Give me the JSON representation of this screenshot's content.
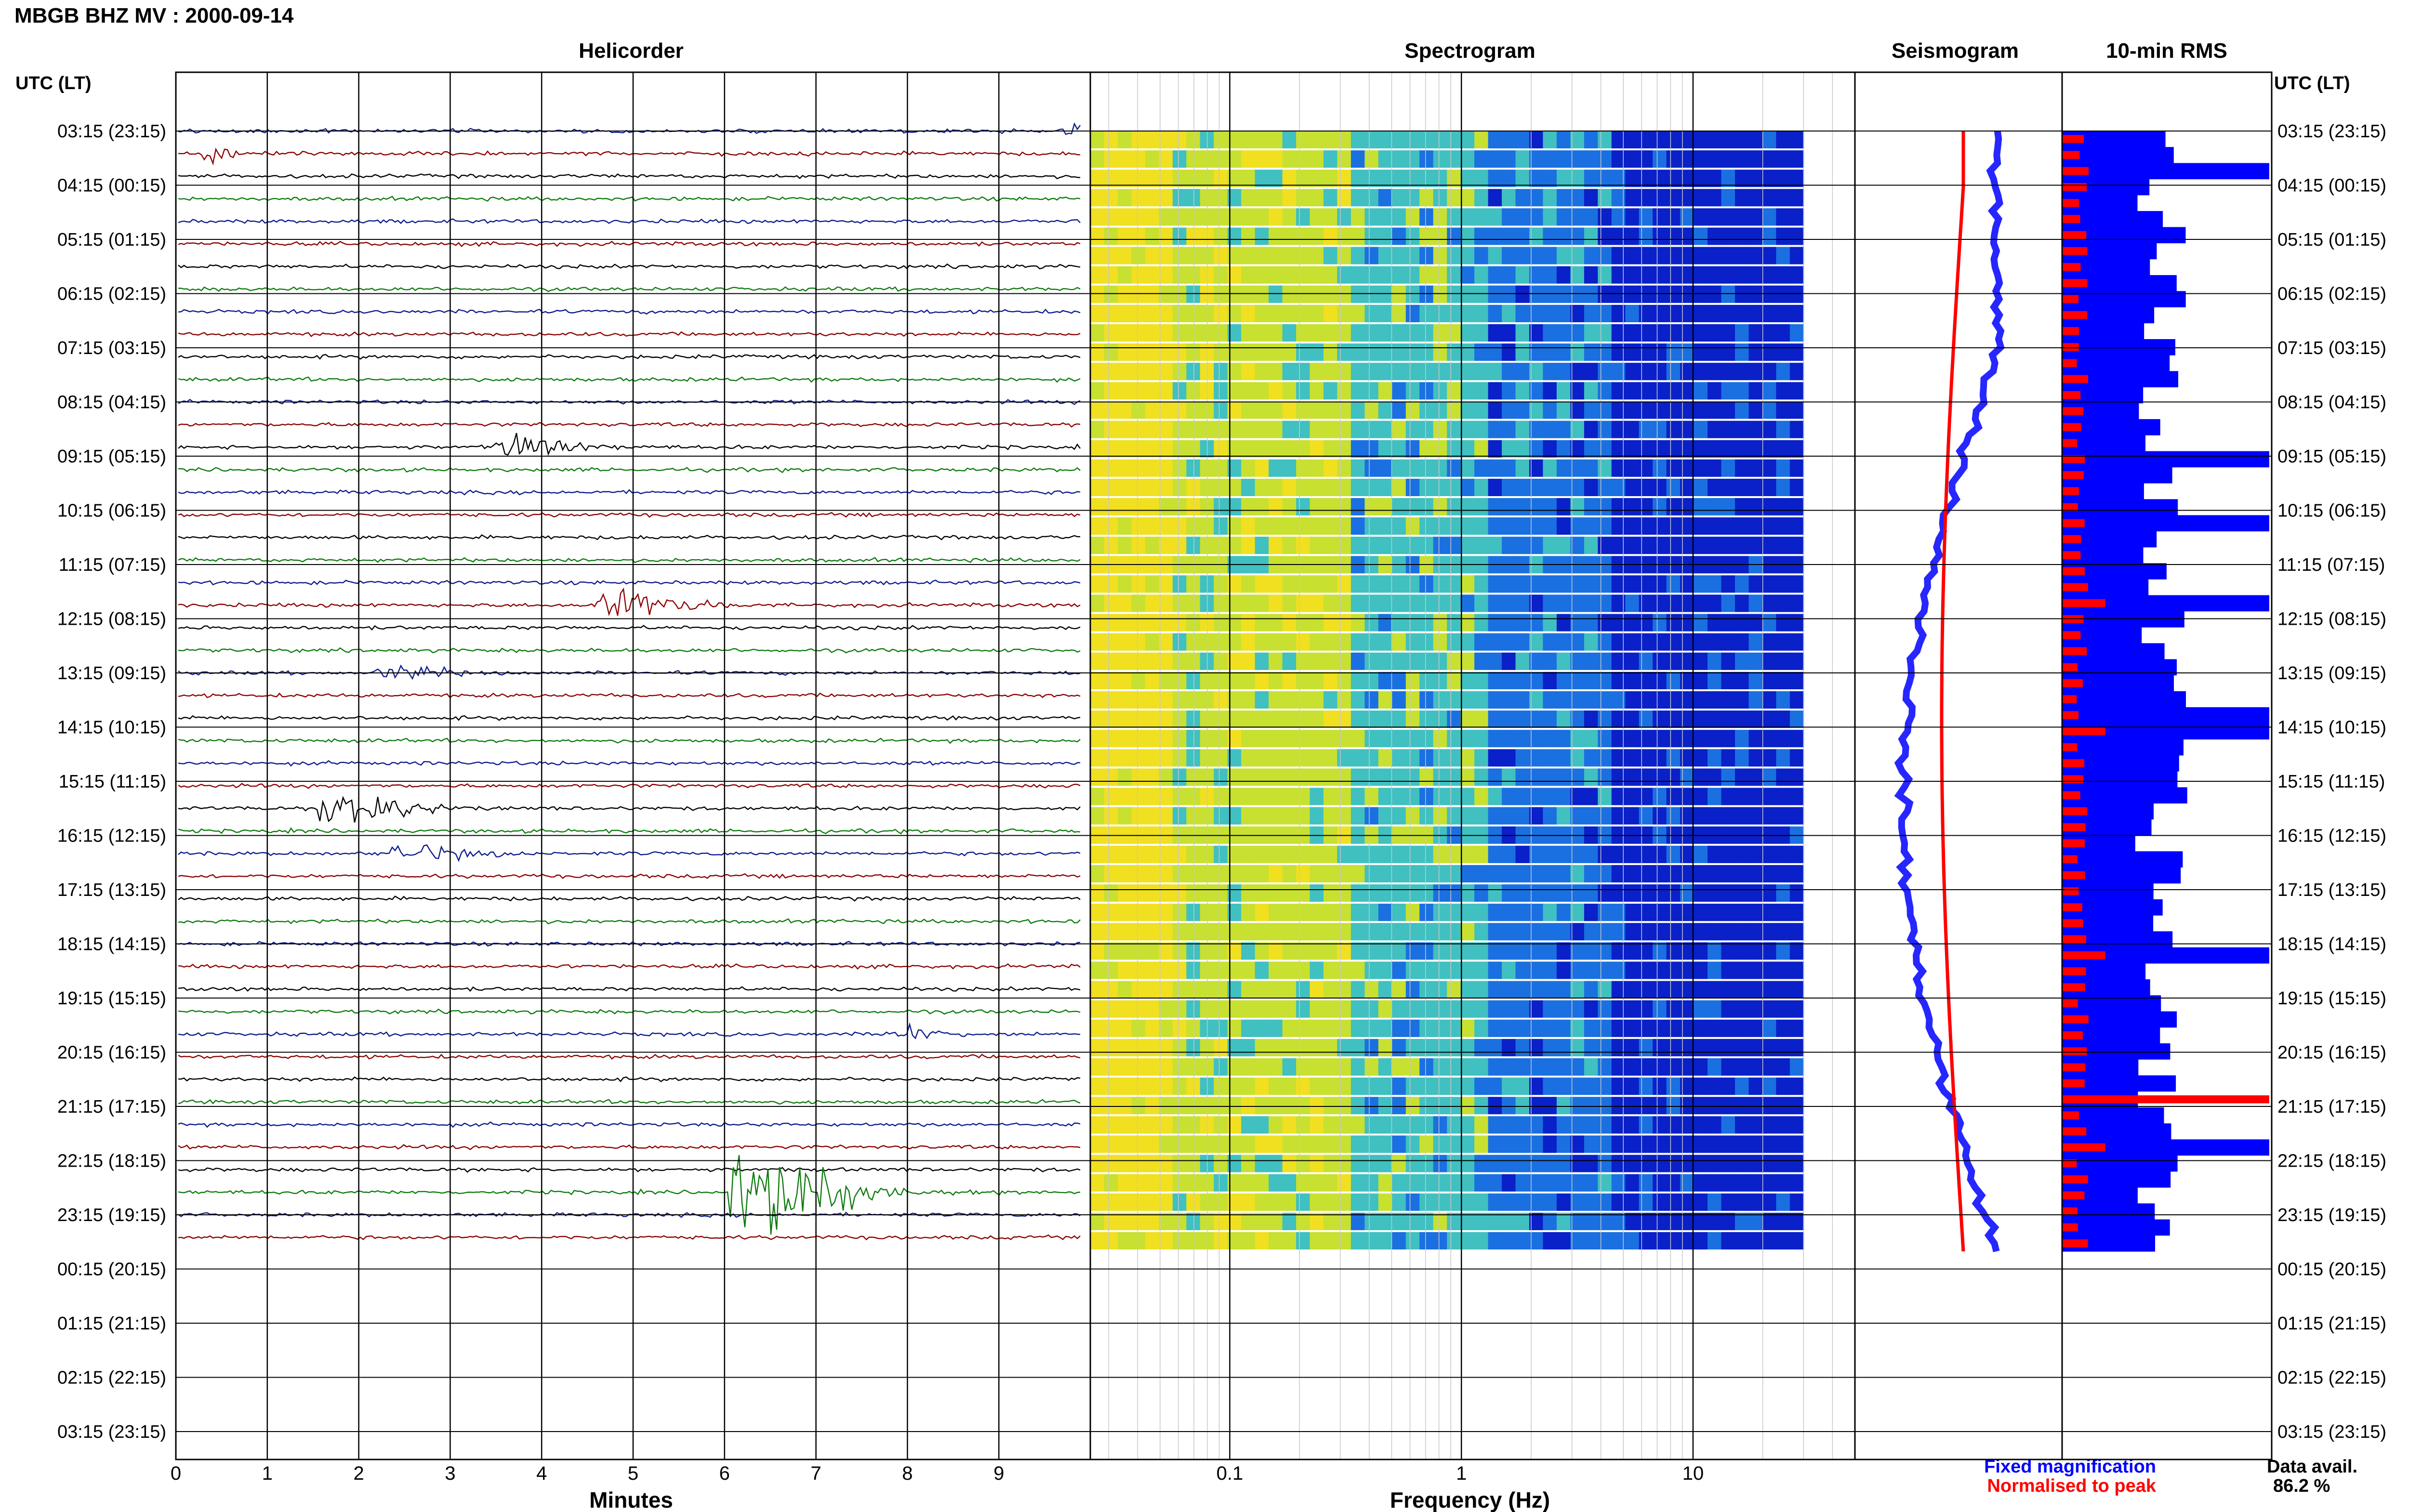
{
  "header": {
    "station_title": "MBGB BHZ MV : 2000-09-14",
    "utc_label": "UTC (LT)",
    "utc_label_right": "UTC (LT)"
  },
  "chart_data": {
    "type": "composite",
    "panels": [
      {
        "name": "helicorder",
        "title": "Helicorder",
        "xlabel": "Minutes",
        "x_ticks": [
          "0",
          "1",
          "2",
          "3",
          "4",
          "5",
          "6",
          "7",
          "8",
          "9"
        ],
        "xlim": [
          0,
          10
        ],
        "trace_colors": [
          "#0a1a8c",
          "#8b0000",
          "#000000",
          "#0b7a0b"
        ],
        "traces_per_row_hour": 6,
        "data_rows": 73,
        "events": [
          {
            "minute": 0.5,
            "row": 1,
            "amp": 14,
            "color": "#0a1a8c",
            "dur": 1.0
          },
          {
            "minute": 9.8,
            "row": 0,
            "amp": 16,
            "color": "#8b0000",
            "dur": 0.3
          },
          {
            "minute": 3.7,
            "row": 14,
            "amp": 22,
            "color": "#0a1a8c",
            "dur": 1.6
          },
          {
            "minute": 4.8,
            "row": 21,
            "amp": 30,
            "color": "#0b7a0b",
            "dur": 1.8
          },
          {
            "minute": 2.4,
            "row": 24,
            "amp": 14,
            "color": "#0a1a8c",
            "dur": 1.5
          },
          {
            "minute": 1.8,
            "row": 30,
            "amp": 45,
            "color": "#000000",
            "dur": 1.8
          },
          {
            "minute": 2.6,
            "row": 32,
            "amp": 14,
            "color": "#8b0000",
            "dur": 2.0
          },
          {
            "minute": 6.3,
            "row": 47,
            "amp": 70,
            "color": "#0a1a8c",
            "dur": 2.5
          },
          {
            "minute": 8.0,
            "row": 40,
            "amp": 12,
            "color": "#0a1a8c",
            "dur": 0.8
          },
          {
            "minute": 8.5,
            "row": 60,
            "amp": 24,
            "color": "#0a1a8c",
            "dur": 1.0
          },
          {
            "minute": 3.0,
            "row": 61,
            "amp": 14,
            "color": "#0b7a0b",
            "dur": 1.3
          },
          {
            "minute": 3.0,
            "row": 53,
            "amp": 10,
            "color": "#8b0000",
            "dur": 0.6
          }
        ]
      },
      {
        "name": "spectrogram",
        "title": "Spectrogram",
        "xlabel": "Frequency (Hz)",
        "x_scale": "log",
        "x_ticks": [
          "0.1",
          "1",
          "10"
        ],
        "xlim": [
          0.025,
          50
        ],
        "data_fmax": 30,
        "colormap": [
          "#f0e020",
          "#c8e030",
          "#40c0c0",
          "#1a70e0",
          "#0a20c8"
        ]
      },
      {
        "name": "seismogram",
        "title": "Seismogram",
        "legend": [
          {
            "label": "Fixed magnification",
            "color": "#0000ff"
          },
          {
            "label": "Normalised to peak",
            "color": "#ff0000"
          }
        ]
      },
      {
        "name": "rms",
        "title": "10-min RMS",
        "series": [
          {
            "name": "Fixed magnification",
            "color": "#0000ff"
          },
          {
            "name": "Normalised to peak",
            "color": "#ff0000"
          }
        ],
        "data_availability_label": "Data avail.",
        "data_availability_value": "86.2 %"
      }
    ],
    "time_ticks": [
      "03:15 (23:15)",
      "04:15 (00:15)",
      "05:15 (01:15)",
      "06:15 (02:15)",
      "07:15 (03:15)",
      "08:15 (04:15)",
      "09:15 (05:15)",
      "10:15 (06:15)",
      "11:15 (07:15)",
      "12:15 (08:15)",
      "13:15 (09:15)",
      "14:15 (10:15)",
      "15:15 (11:15)",
      "16:15 (12:15)",
      "17:15 (13:15)",
      "18:15 (14:15)",
      "19:15 (15:15)",
      "20:15 (16:15)",
      "21:15 (17:15)",
      "22:15 (18:15)",
      "23:15 (19:15)",
      "00:15 (20:15)",
      "01:15 (21:15)",
      "02:15 (22:15)",
      "03:15 (23:15)"
    ]
  }
}
